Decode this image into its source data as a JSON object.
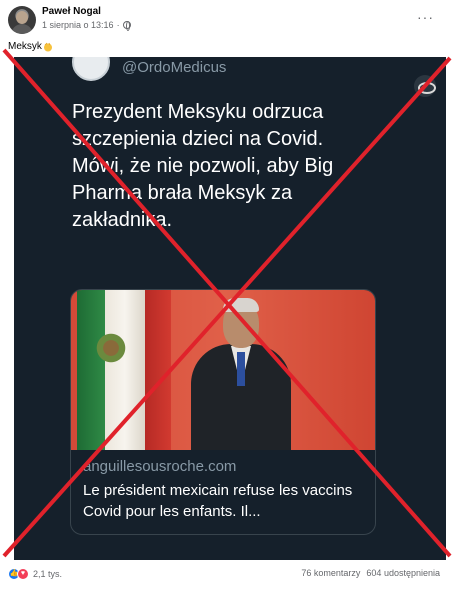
{
  "post": {
    "author": "Paweł Nogal",
    "date": "1 sierpnia o 13:16",
    "separator": "·",
    "text": "Meksyk",
    "more_label": "···"
  },
  "tweet": {
    "handle": "@OrdoMedicus",
    "body": "Prezydent Meksyku odrzuca szczepienia dzieci na Covid. Mówi, że nie pozwoli, aby Big Pharma brała Meksyk za zakładnika.",
    "card": {
      "domain": "anguillesousroche.com",
      "title": "Le président mexicain refuse les vaccins Covid pour les enfants. Il..."
    }
  },
  "footer": {
    "reactions_count": "2,1 tys.",
    "comments": "76 komentarzy",
    "shares": "604 udostępnienia"
  },
  "icons": {
    "globe": "globe-icon",
    "clap": "clap-emoji-icon",
    "like": "like-icon",
    "love": "love-icon"
  },
  "colors": {
    "cross": "#e0222b",
    "tweet_bg": "#15202b",
    "like": "#1877f2",
    "love": "#f33e58"
  }
}
